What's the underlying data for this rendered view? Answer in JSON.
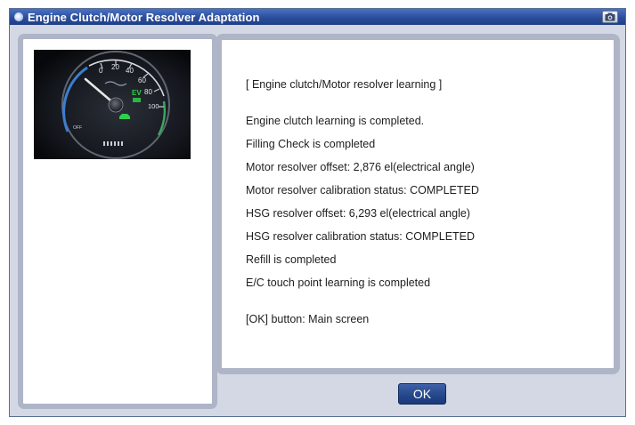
{
  "window": {
    "title": "Engine Clutch/Motor Resolver Adaptation",
    "title_icon": "app-icon",
    "camera_icon": "camera-icon"
  },
  "gauge": {
    "icon": "speedometer-image",
    "ticks": [
      "0",
      "20",
      "40",
      "60",
      "80",
      "100"
    ],
    "ev_label": "EV",
    "off_label": "OFF",
    "colors": {
      "needle": "#e8e8e8",
      "ring_blue": "#3a7fd0",
      "ev_green": "#2fcf4a"
    }
  },
  "messages": {
    "header": "[ Engine clutch/Motor resolver learning ]",
    "lines": [
      "Engine clutch learning is completed.",
      "Filling Check is completed",
      "Motor resolver offset: 2,876 el(electrical angle)",
      "Motor resolver calibration status: COMPLETED",
      "HSG resolver offset: 6,293 el(electrical angle)",
      "HSG resolver calibration status: COMPLETED",
      "Refill is completed",
      "E/C touch point learning is completed"
    ],
    "footer": "[OK] button: Main screen"
  },
  "buttons": {
    "ok_label": "OK"
  }
}
